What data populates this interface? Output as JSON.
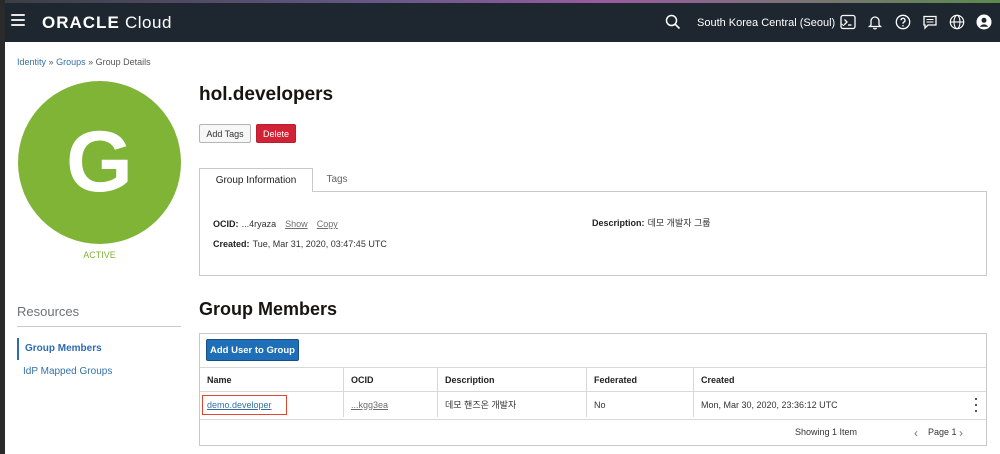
{
  "topbar": {
    "logo_bold": "ORACLE",
    "logo_light": " Cloud",
    "region": "South Korea Central (Seoul)",
    "icons": [
      "menu-icon",
      "search-icon",
      "chevron-down-icon",
      "cloud-shell-icon",
      "bell-icon",
      "help-icon",
      "chat-icon",
      "globe-icon",
      "user-icon"
    ]
  },
  "breadcrumb": {
    "items": [
      "Identity",
      "Groups",
      "Group Details"
    ],
    "separator": "»"
  },
  "avatar": {
    "letter": "G",
    "status": "ACTIVE",
    "color": "#7fb437"
  },
  "resources": {
    "title": "Resources",
    "items": [
      "Group Members",
      "IdP Mapped Groups"
    ]
  },
  "page": {
    "title": "hol.developers",
    "add_tags": "Add Tags",
    "delete": "Delete"
  },
  "tabs": [
    "Group Information",
    "Tags"
  ],
  "group_info": {
    "ocid_label": "OCID:",
    "ocid_value": "...4ryaza",
    "show": "Show",
    "copy": "Copy",
    "created_label": "Created:",
    "created_value": "Tue, Mar 31, 2020, 03:47:45 UTC",
    "description_label": "Description:",
    "description_value": "데모 개발자 그룹"
  },
  "members": {
    "title": "Group Members",
    "add_user": "Add User to Group",
    "columns": [
      "Name",
      "OCID",
      "Description",
      "Federated",
      "Created"
    ],
    "rows": [
      {
        "name": "demo.developer",
        "ocid": "...kgg3ea",
        "description": "데모 핸즈온 개발자",
        "federated": "No",
        "created": "Mon, Mar 30, 2020, 23:36:12 UTC"
      }
    ],
    "showing": "Showing 1 Item",
    "page": "Page 1"
  },
  "colors": {
    "topbar": "#1e2730",
    "link": "#3470a8",
    "delete": "#d12335",
    "primary": "#1f6fb8",
    "status_active": "#7fb437"
  }
}
